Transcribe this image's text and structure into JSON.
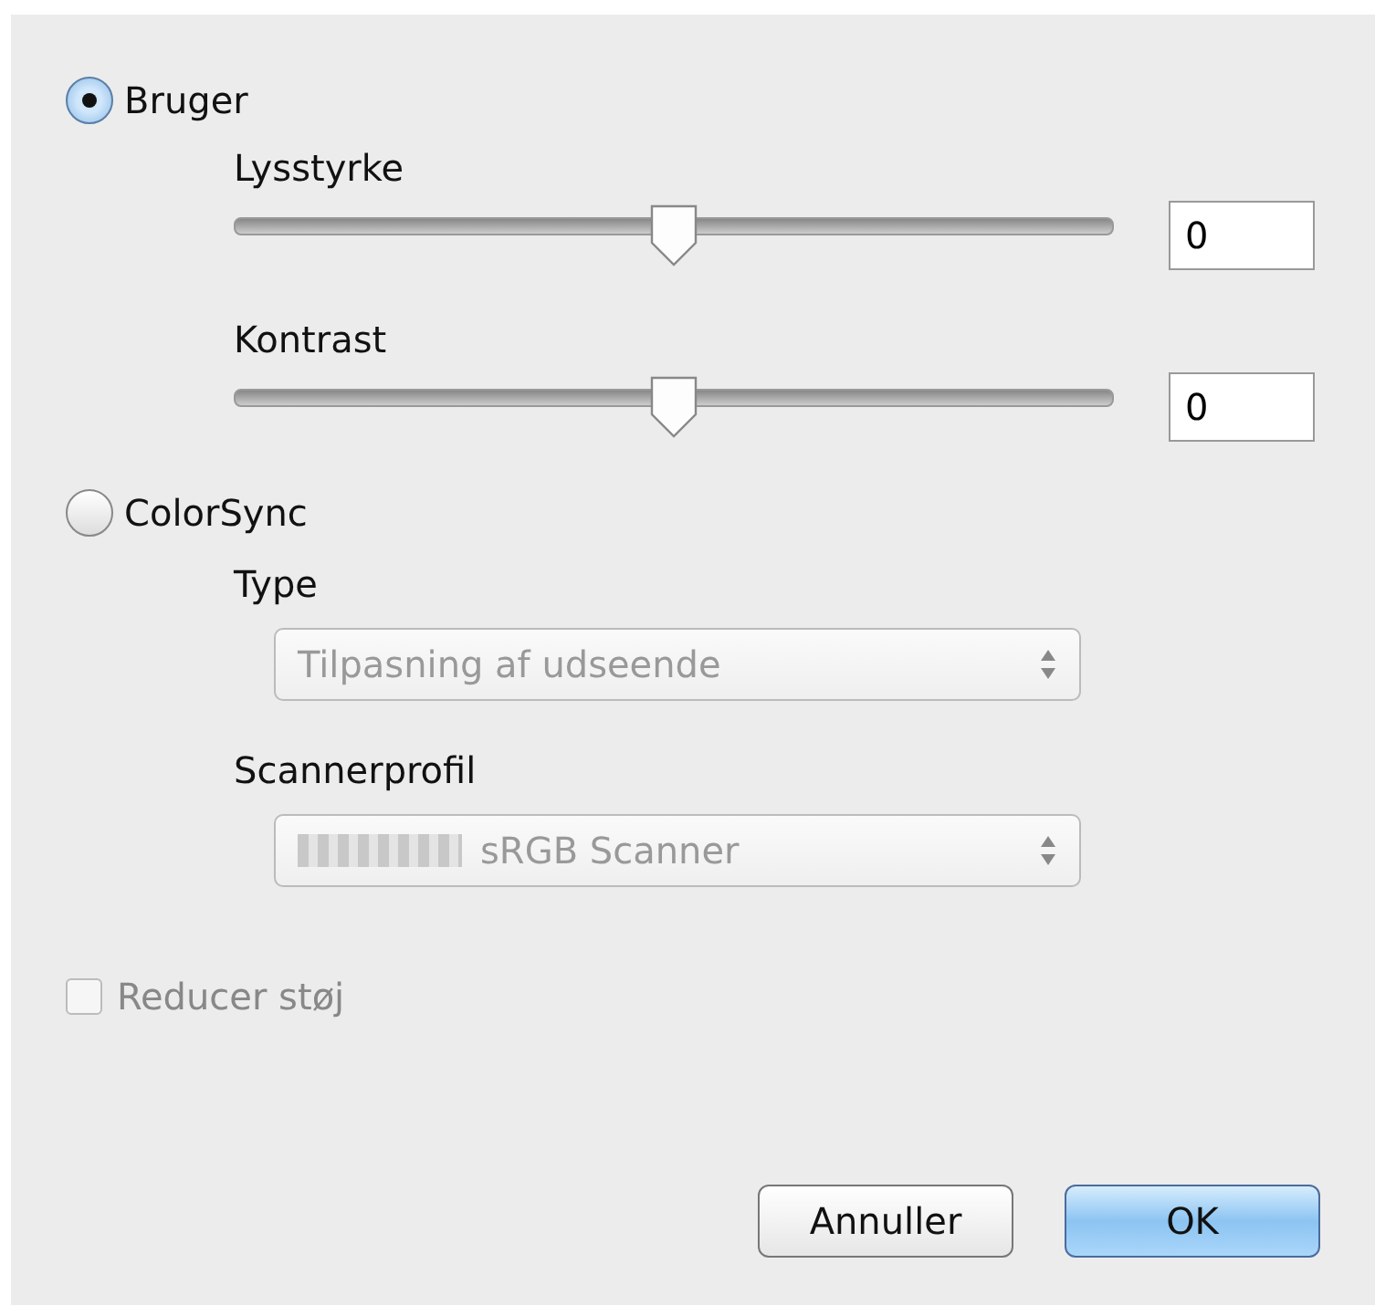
{
  "modes": [
    {
      "label": "Bruger",
      "selected": true
    },
    {
      "label": "ColorSync",
      "selected": false
    }
  ],
  "sliders": [
    {
      "label": "Lysstyrke",
      "level": 0.5,
      "value": "0"
    },
    {
      "label": "Kontrast",
      "level": 0.5,
      "value": "0"
    }
  ],
  "dropdowns": [
    {
      "label": "Type",
      "value": "Tilpasning af udseende",
      "disabled": true,
      "redacted_prefix": false
    },
    {
      "label": "Scannerprofil",
      "value": "sRGB Scanner",
      "disabled": true,
      "redacted_prefix": true
    }
  ],
  "noise_reduction": {
    "label": "Reducer støj",
    "checked": false,
    "disabled": true
  },
  "buttons": [
    {
      "label": "Annuller",
      "default": false
    },
    {
      "label": "OK",
      "default": true
    }
  ]
}
